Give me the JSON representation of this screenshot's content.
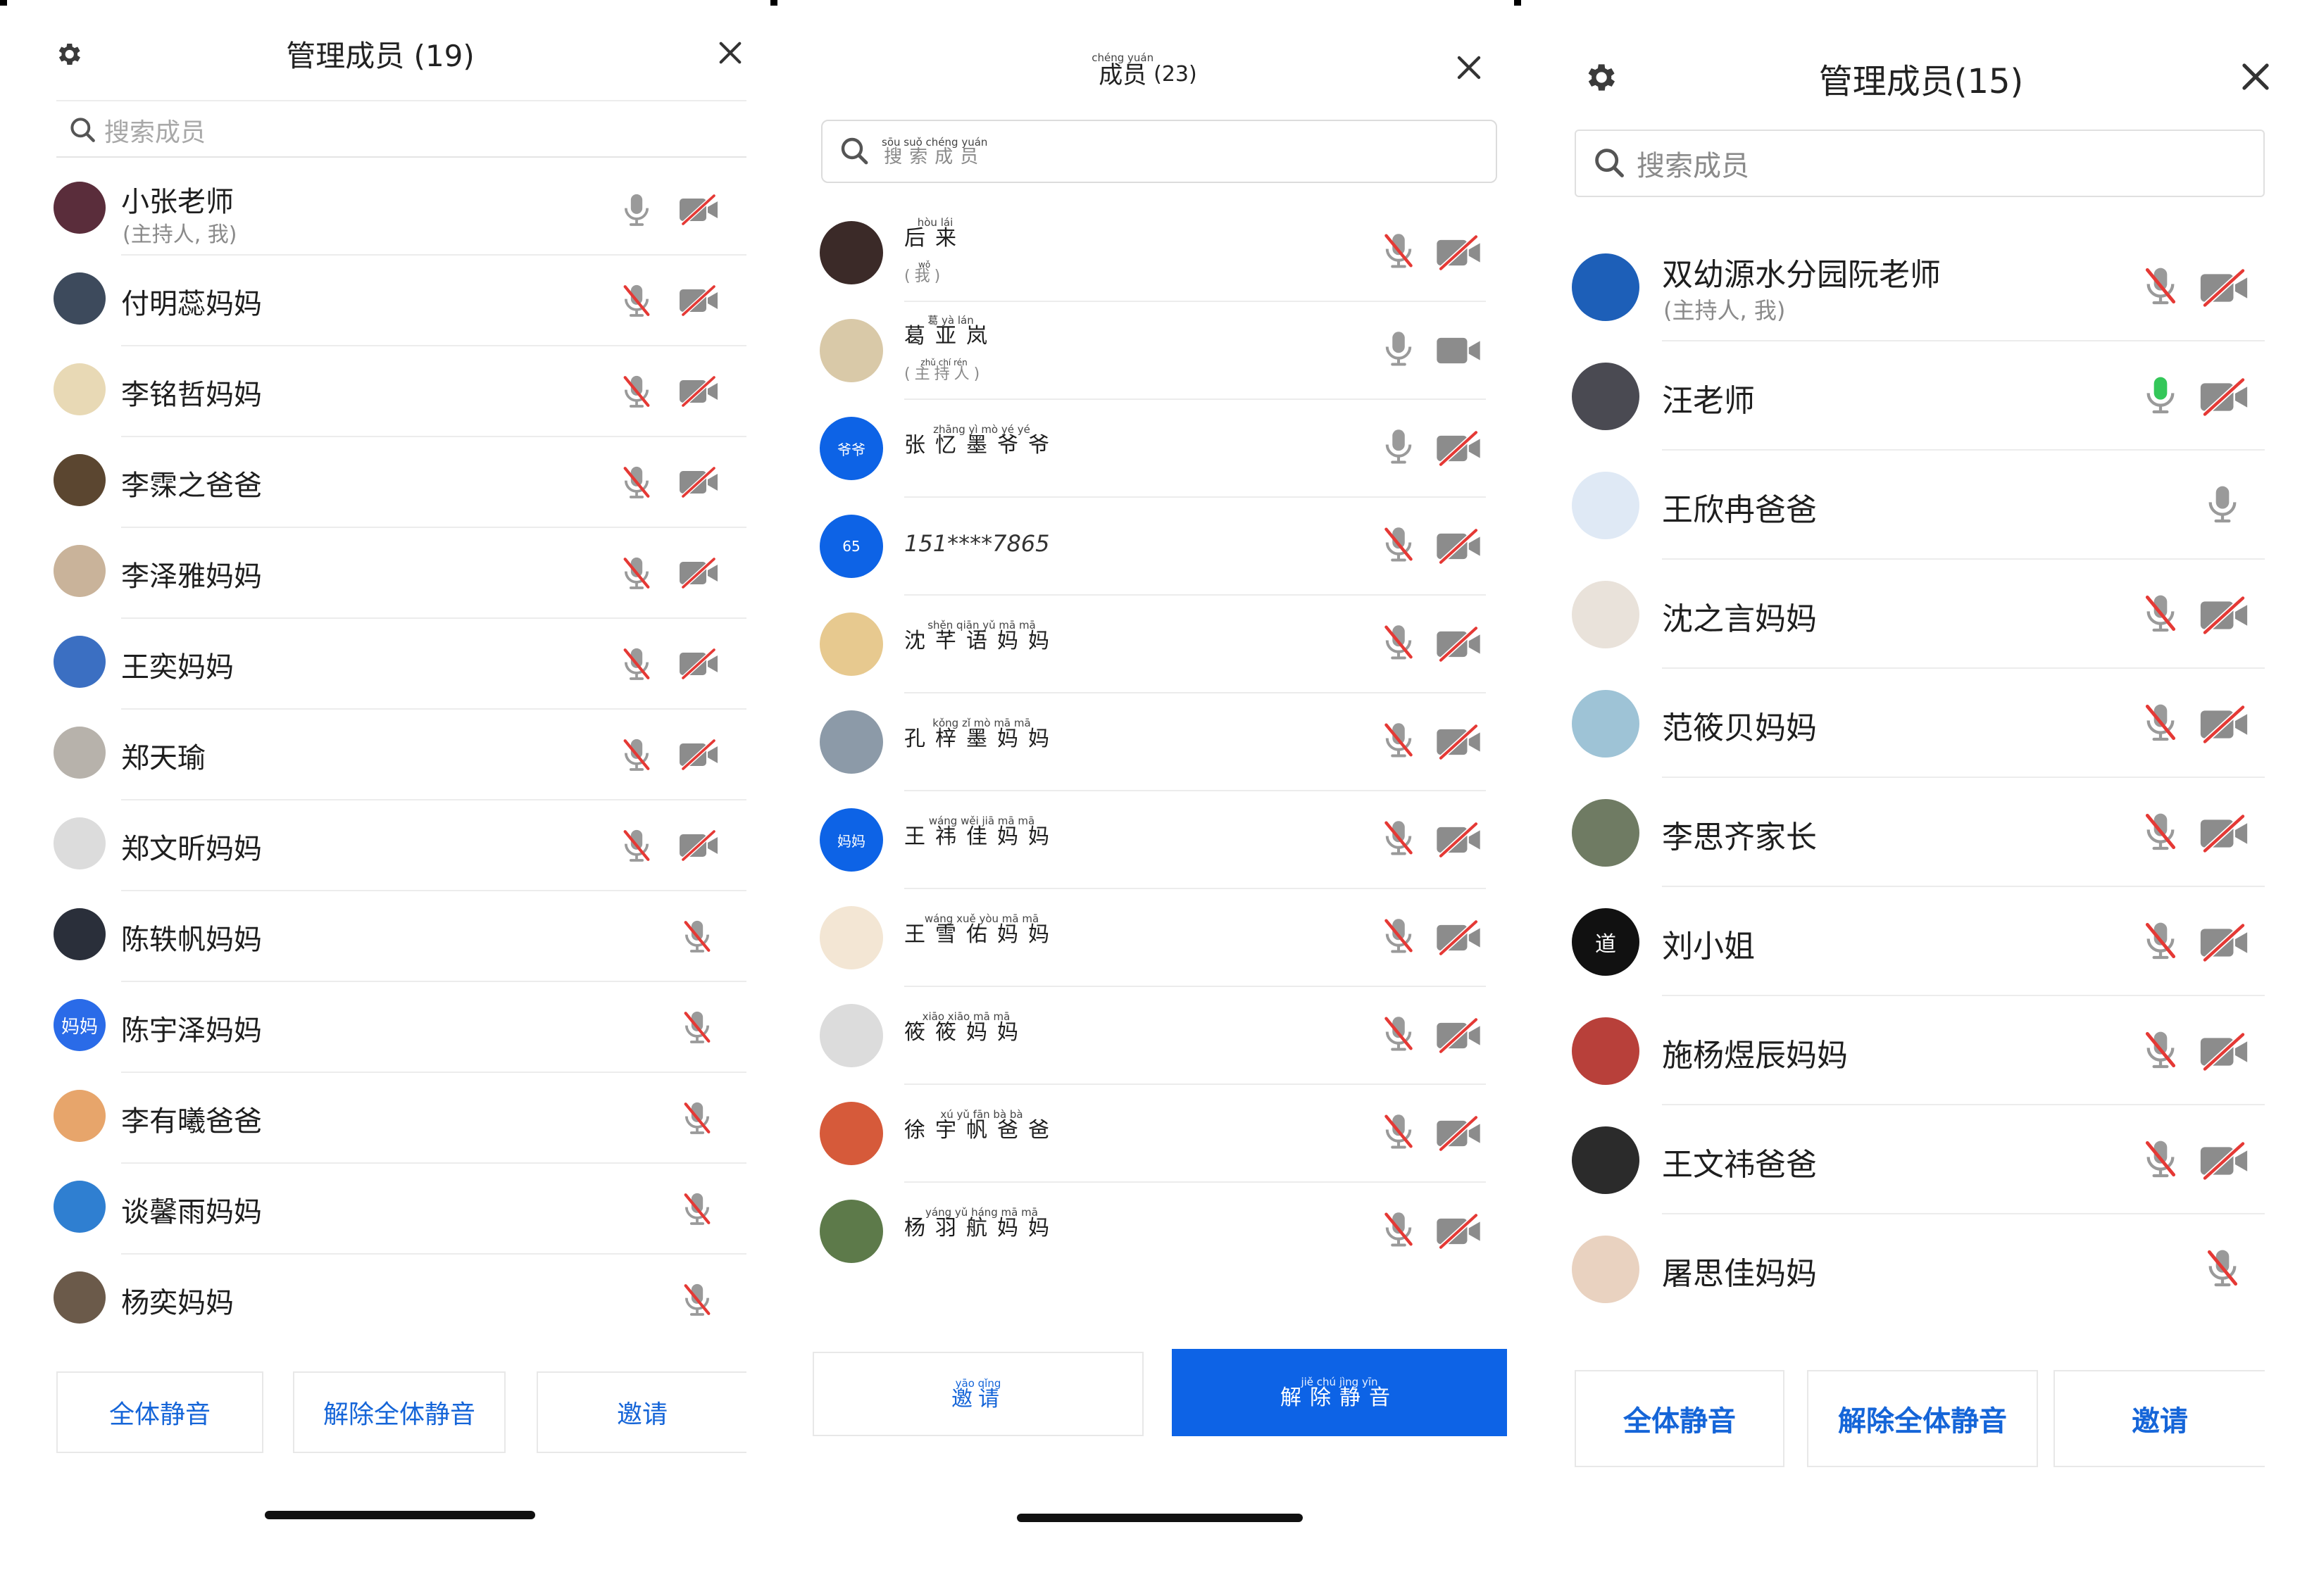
{
  "panel1": {
    "title": "管理成员 (19)",
    "search_placeholder": "搜索成员",
    "members": [
      {
        "name": "小张老师",
        "sub": "(主持人, 我)",
        "mic": "on",
        "cam": "off",
        "avatar_color": "#5a2d3b"
      },
      {
        "name": "付明蕊妈妈",
        "mic": "muted",
        "cam": "off",
        "avatar_color": "#3d4a5c"
      },
      {
        "name": "李铭哲妈妈",
        "mic": "muted",
        "cam": "off",
        "avatar_color": "#e8d9b5"
      },
      {
        "name": "李霂之爸爸",
        "mic": "muted",
        "cam": "off",
        "avatar_color": "#5b4630"
      },
      {
        "name": "李泽雅妈妈",
        "mic": "muted",
        "cam": "off",
        "avatar_color": "#c9b39a"
      },
      {
        "name": "王奕妈妈",
        "mic": "muted",
        "cam": "off",
        "avatar_color": "#3b6fc2"
      },
      {
        "name": "郑天瑜",
        "mic": "muted",
        "cam": "off",
        "avatar_color": "#b7b2ab"
      },
      {
        "name": "郑文昕妈妈",
        "mic": "muted",
        "cam": "off",
        "avatar_color": "#dcdcdc"
      },
      {
        "name": "陈轶帆妈妈",
        "mic": "muted",
        "avatar_color": "#2a2f3a"
      },
      {
        "name": "陈宇泽妈妈",
        "mic": "muted",
        "avatar_color": "#2a6be8",
        "avatar_text": "妈妈"
      },
      {
        "name": "李有曦爸爸",
        "mic": "muted",
        "avatar_color": "#e7a56b"
      },
      {
        "name": "谈馨雨妈妈",
        "mic": "muted",
        "avatar_color": "#2f7fd1"
      },
      {
        "name": "杨奕妈妈",
        "mic": "muted",
        "avatar_color": "#6b5a4a"
      }
    ],
    "buttons": {
      "mute_all": "全体静音",
      "unmute_all": "解除全体静音",
      "invite": "邀请"
    }
  },
  "panel2": {
    "title_pinyin": "chéng yuán",
    "title_hanzi": "成员",
    "title_count": "(23)",
    "search_pinyin": "sōu suǒ chéng yuán",
    "search_hanzi": "搜索成员",
    "members": [
      {
        "py": "hòu lái",
        "hz": "后来",
        "sub_py": "wǒ",
        "sub_hz": "(我)",
        "mic": "muted",
        "cam": "off",
        "avatar_color": "#3b2a28"
      },
      {
        "py": "葛 yà lán",
        "hz": "葛亚岚",
        "sub_py": "zhǔ chí rén",
        "sub_hz": "(主持人)",
        "mic": "on",
        "cam": "on",
        "avatar_color": "#d9c9a8"
      },
      {
        "py": "zhāng yì mò yé yé",
        "hz": "张忆墨爷爷",
        "mic": "on",
        "cam": "off",
        "avatar_color": "#0d63e6",
        "avatar_text": "爷爷"
      },
      {
        "name": "151****7865",
        "mic": "muted",
        "cam": "off",
        "avatar_color": "#0d63e6",
        "avatar_text": "65"
      },
      {
        "py": "shěn qiān yǔ mā mā",
        "hz": "沈芊语妈妈",
        "mic": "muted",
        "cam": "off",
        "avatar_color": "#e7c98f"
      },
      {
        "py": "kǒng zǐ mò mā mā",
        "hz": "孔梓墨妈妈",
        "mic": "muted",
        "cam": "off",
        "avatar_color": "#8c9aa8"
      },
      {
        "py": "wáng wěi jiā mā mā",
        "hz": "王祎佳妈妈",
        "mic": "muted",
        "cam": "off",
        "avatar_color": "#0d63e6",
        "avatar_text": "妈妈"
      },
      {
        "py": "wáng xuě yòu mā mā",
        "hz": "王雪佑妈妈",
        "mic": "muted",
        "cam": "off",
        "avatar_color": "#f3e6d4"
      },
      {
        "py": "xiāo xiāo mā mā",
        "hz": "筱筱妈妈",
        "mic": "muted",
        "cam": "off",
        "avatar_color": "#dcdcdc"
      },
      {
        "py": "xú yǔ fān bà bà",
        "hz": "徐宇帆爸爸",
        "mic": "muted",
        "cam": "off",
        "avatar_color": "#d65a3a"
      },
      {
        "py": "yáng yǔ háng mā mā",
        "hz": "杨羽航妈妈",
        "mic": "muted",
        "cam": "off",
        "avatar_color": "#5d7a4a"
      }
    ],
    "buttons": {
      "invite_py": "yāo qǐng",
      "invite_hz": "邀请",
      "unmute_py": "jiě chú jìng yīn",
      "unmute_hz": "解除静音"
    }
  },
  "panel3": {
    "title": "管理成员(15)",
    "search_placeholder": "搜索成员",
    "members": [
      {
        "name": "双幼源水分园阮老师",
        "sub": "(主持人, 我)",
        "mic": "muted",
        "cam": "off",
        "avatar_color": "#1d5fb8"
      },
      {
        "name": "汪老师",
        "mic": "active",
        "cam": "off",
        "avatar_color": "#4a4a52"
      },
      {
        "name": "王欣冉爸爸",
        "mic": "on",
        "avatar_color": "#dfe9f5"
      },
      {
        "name": "沈之言妈妈",
        "mic": "muted",
        "cam": "off",
        "avatar_color": "#e9e2da"
      },
      {
        "name": "范筱贝妈妈",
        "mic": "muted",
        "cam": "off",
        "avatar_color": "#9ec3d6"
      },
      {
        "name": "李思齐家长",
        "mic": "muted",
        "cam": "off",
        "avatar_color": "#6f7b63"
      },
      {
        "name": "刘小姐",
        "mic": "muted",
        "cam": "off",
        "avatar_color": "#111111",
        "avatar_text": "道"
      },
      {
        "name": "施杨煜辰妈妈",
        "mic": "muted",
        "cam": "off",
        "avatar_color": "#b8403a"
      },
      {
        "name": "王文祎爸爸",
        "mic": "muted",
        "cam": "off",
        "avatar_color": "#2b2b2b"
      },
      {
        "name": "屠思佳妈妈",
        "mic": "muted",
        "avatar_color": "#e9d2c0"
      }
    ],
    "buttons": {
      "mute_all": "全体静音",
      "unmute_all": "解除全体静音",
      "invite": "邀请"
    }
  },
  "colors": {
    "accent": "#0d63e6",
    "button_text": "#1565d8",
    "muted_red": "#e53935",
    "mic_active": "#34c759",
    "icon_gray": "#9a9a9a"
  }
}
